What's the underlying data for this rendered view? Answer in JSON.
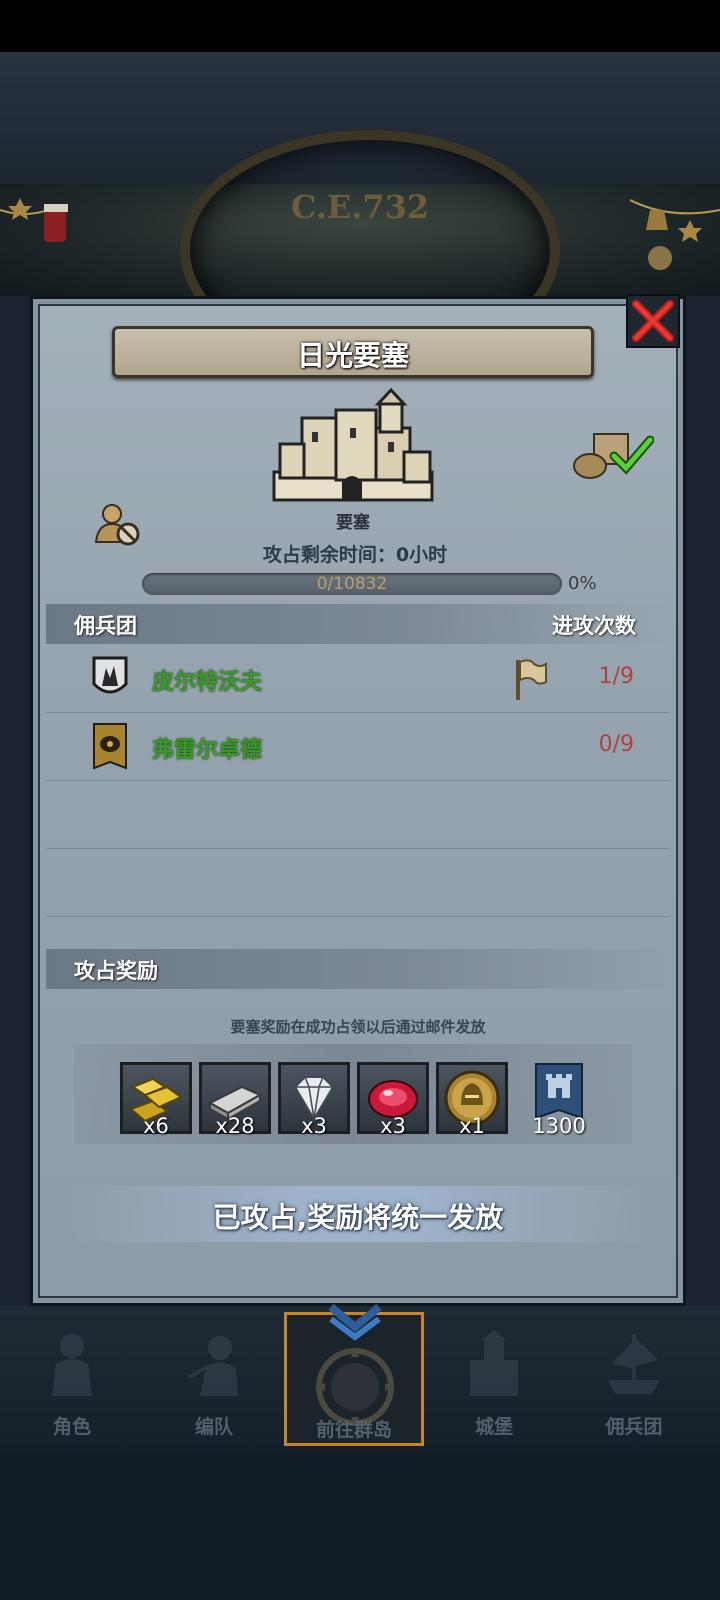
{
  "header": {
    "era": "C.E.732"
  },
  "panel": {
    "title": "日光要塞",
    "fort_type": "要塞",
    "time_label": "攻占剩余时间：0小时",
    "progress": {
      "current": 0,
      "total": 10832,
      "text": "0/10832",
      "percent_text": "0%",
      "percent": 0
    },
    "mercenary_section": {
      "title": "佣兵团",
      "attack_count_title": "进攻次数",
      "rows": [
        {
          "name": "皮尔特沃夫",
          "count": "1/9",
          "emblem": "shield-crown-icon",
          "has_flag": true
        },
        {
          "name": "弗雷尔卓德",
          "count": "0/9",
          "emblem": "eye-banner-icon",
          "has_flag": false
        }
      ]
    },
    "reward_section": {
      "title": "攻占奖励",
      "note": "要塞奖励在成功占领以后通过邮件发放",
      "items": [
        {
          "icon": "gold-bars-icon",
          "qty": "x6"
        },
        {
          "icon": "iron-ingot-icon",
          "qty": "x28"
        },
        {
          "icon": "diamond-icon",
          "qty": "x3"
        },
        {
          "icon": "ruby-icon",
          "qty": "x3"
        },
        {
          "icon": "helmet-coin-icon",
          "qty": "x1"
        },
        {
          "icon": "castle-banner-icon",
          "qty": "1300"
        }
      ]
    },
    "status_text": "已攻占,奖励将统一发放"
  },
  "bottom_nav": {
    "items": [
      {
        "label": "角色",
        "icon": "knight-icon"
      },
      {
        "label": "编队",
        "icon": "formation-icon"
      },
      {
        "label": "前往群岛",
        "icon": "islands-icon",
        "active": true
      },
      {
        "label": "城堡",
        "icon": "castle-icon"
      },
      {
        "label": "佣兵团",
        "icon": "ship-icon"
      }
    ]
  },
  "colors": {
    "merc_name": "#3b9a27",
    "attack_count": "#b0423e",
    "active_nav_border": "#c78428"
  }
}
